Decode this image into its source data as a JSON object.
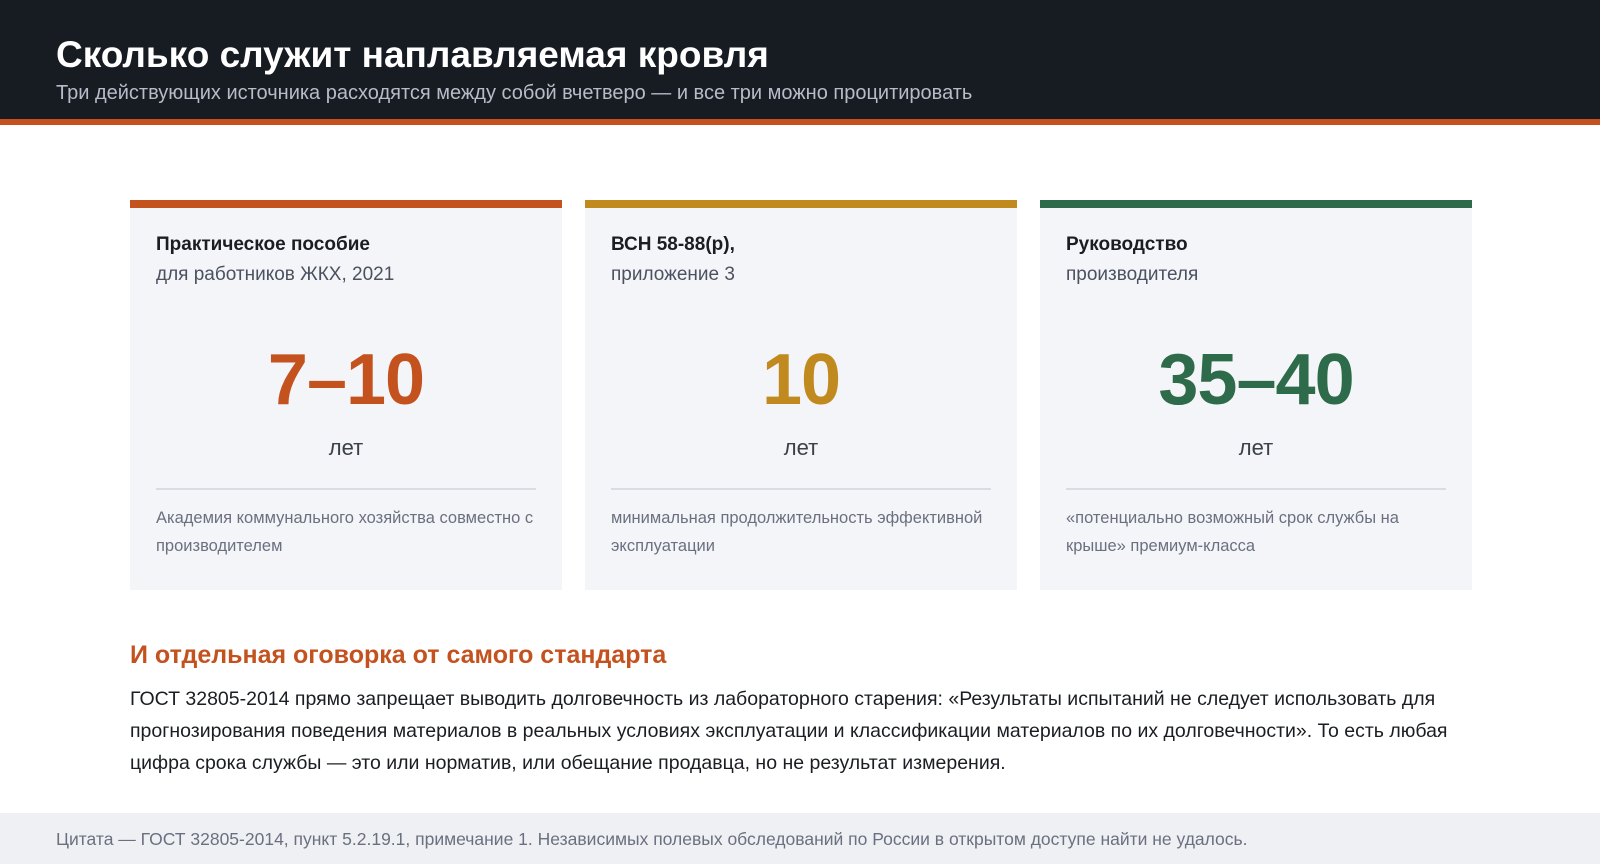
{
  "header": {
    "title": "Сколько служит наплавляемая кровля",
    "subtitle": "Три действующих источника расходятся между собой вчетверо — и все три можно процитировать"
  },
  "colors": {
    "accent": "#c4521f",
    "card1": "#c4521f",
    "card2": "#c08a1e",
    "card3": "#2e6b4a",
    "header_bg": "#171b22"
  },
  "cards": [
    {
      "source_bold": "Практическое пособие",
      "source_sub": "для работников ЖКХ, 2021",
      "value": "7–10",
      "unit": "лет",
      "note": "Академия коммунального хозяйства совместно с производителем"
    },
    {
      "source_bold": "ВСН 58-88(р),",
      "source_sub": "приложение 3",
      "value": "10",
      "unit": "лет",
      "note": "минимальная продолжительность эффективной эксплуатации"
    },
    {
      "source_bold": "Руководство",
      "source_sub": "производителя",
      "value": "35–40",
      "unit": "лет",
      "note": "«потенциально возможный срок службы на крыше» премиум-класса"
    }
  ],
  "section": {
    "title": "И отдельная оговорка от самого стандарта",
    "body": "ГОСТ 32805-2014 прямо запрещает выводить долговечность из лабораторного старения: «Результаты испытаний не следует использовать для прогнозирования поведения материалов в реальных условиях эксплуатации и классификации материалов по их долговечности». То есть любая цифра срока службы — это или норматив, или обещание продавца, но не результат измерения."
  },
  "footer": {
    "text": "Цитата — ГОСТ 32805-2014, пункт 5.2.19.1, примечание 1. Независимых полевых обследований по России в открытом доступе найти не удалось."
  }
}
